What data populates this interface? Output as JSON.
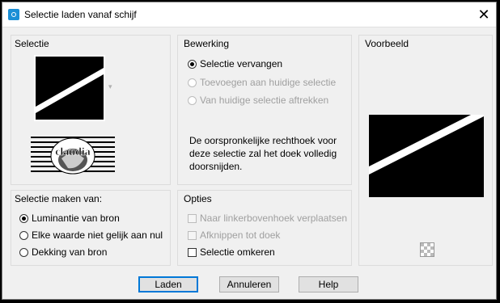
{
  "window": {
    "title": "Selectie laden vanaf schijf",
    "close_glyph": "✕"
  },
  "selectie": {
    "title": "Selectie",
    "dropdown_glyph": "▾"
  },
  "bewerking": {
    "title": "Bewerking",
    "options": [
      {
        "label": "Selectie vervangen",
        "checked": true,
        "enabled": true
      },
      {
        "label": "Toevoegen aan huidige selectie",
        "checked": false,
        "enabled": false
      },
      {
        "label": "Van huidige selectie aftrekken",
        "checked": false,
        "enabled": false
      }
    ],
    "note": "De oorspronkelijke rechthoek voor deze selectie zal het doek volledig doorsnijden."
  },
  "voorbeeld": {
    "title": "Voorbeeld"
  },
  "selectie_maken": {
    "title": "Selectie maken van:",
    "options": [
      {
        "label": "Luminantie van bron",
        "checked": true
      },
      {
        "label": "Elke waarde niet gelijk aan nul",
        "checked": false
      },
      {
        "label": "Dekking van bron",
        "checked": false
      }
    ]
  },
  "opties": {
    "title": "Opties",
    "items": [
      {
        "label": "Naar linkerbovenhoek verplaatsen",
        "checked": false,
        "enabled": false
      },
      {
        "label": "Afknippen tot doek",
        "checked": false,
        "enabled": false
      },
      {
        "label": "Selectie omkeren",
        "checked": false,
        "enabled": true
      }
    ]
  },
  "buttons": {
    "laden": "Laden",
    "annuleren": "Annuleren",
    "help": "Help"
  },
  "watermark": {
    "text": "claudia"
  }
}
